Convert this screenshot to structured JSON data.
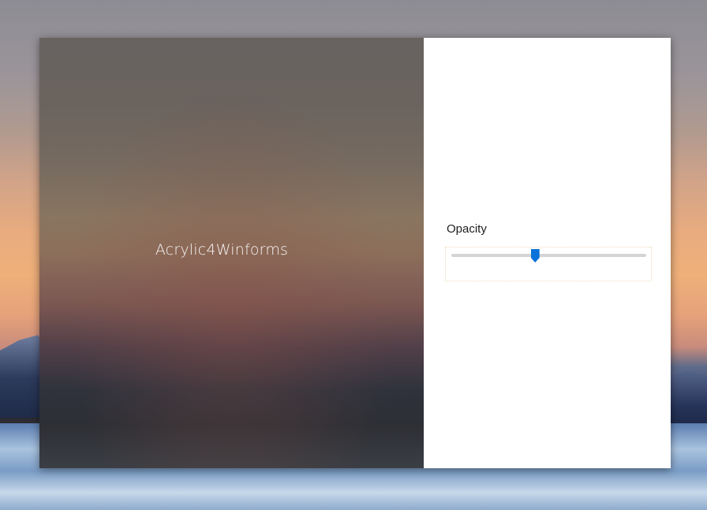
{
  "window": {
    "acrylic_title": "Acrylic4Winforms"
  },
  "panel": {
    "opacity_label": "Opacity",
    "opacity_slider": {
      "value_fraction": 0.43
    }
  },
  "colors": {
    "accent": "#0a72d8",
    "panel_background": "#ffffff",
    "track": "#d4d4d4"
  }
}
